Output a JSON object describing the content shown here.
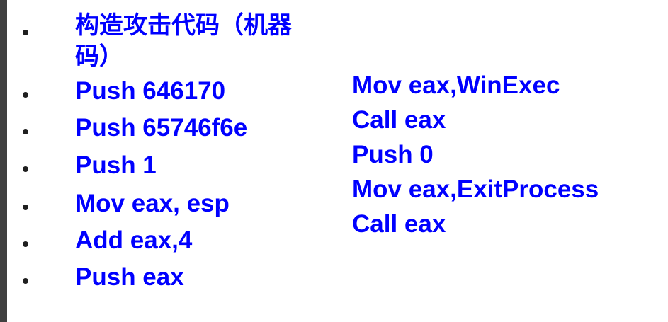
{
  "slide": {
    "bullets": [
      {
        "line1": "构造攻击代码（机器",
        "line2": "码）"
      },
      {
        "text": "Push 646170"
      },
      {
        "text": "Push 65746f6e"
      },
      {
        "text": "Push 1"
      },
      {
        "text": "Mov eax, esp"
      },
      {
        "text": "Add eax,4"
      },
      {
        "text": "Push eax"
      }
    ],
    "right_lines": [
      "Mov eax,WinExec",
      "Call eax",
      "Push 0",
      "Mov eax,ExitProcess",
      "Call eax"
    ]
  },
  "colors": {
    "text": "#0000ff",
    "bullet": "#1f1f1f",
    "left_strip": "#404040",
    "background": "#ffffff"
  }
}
